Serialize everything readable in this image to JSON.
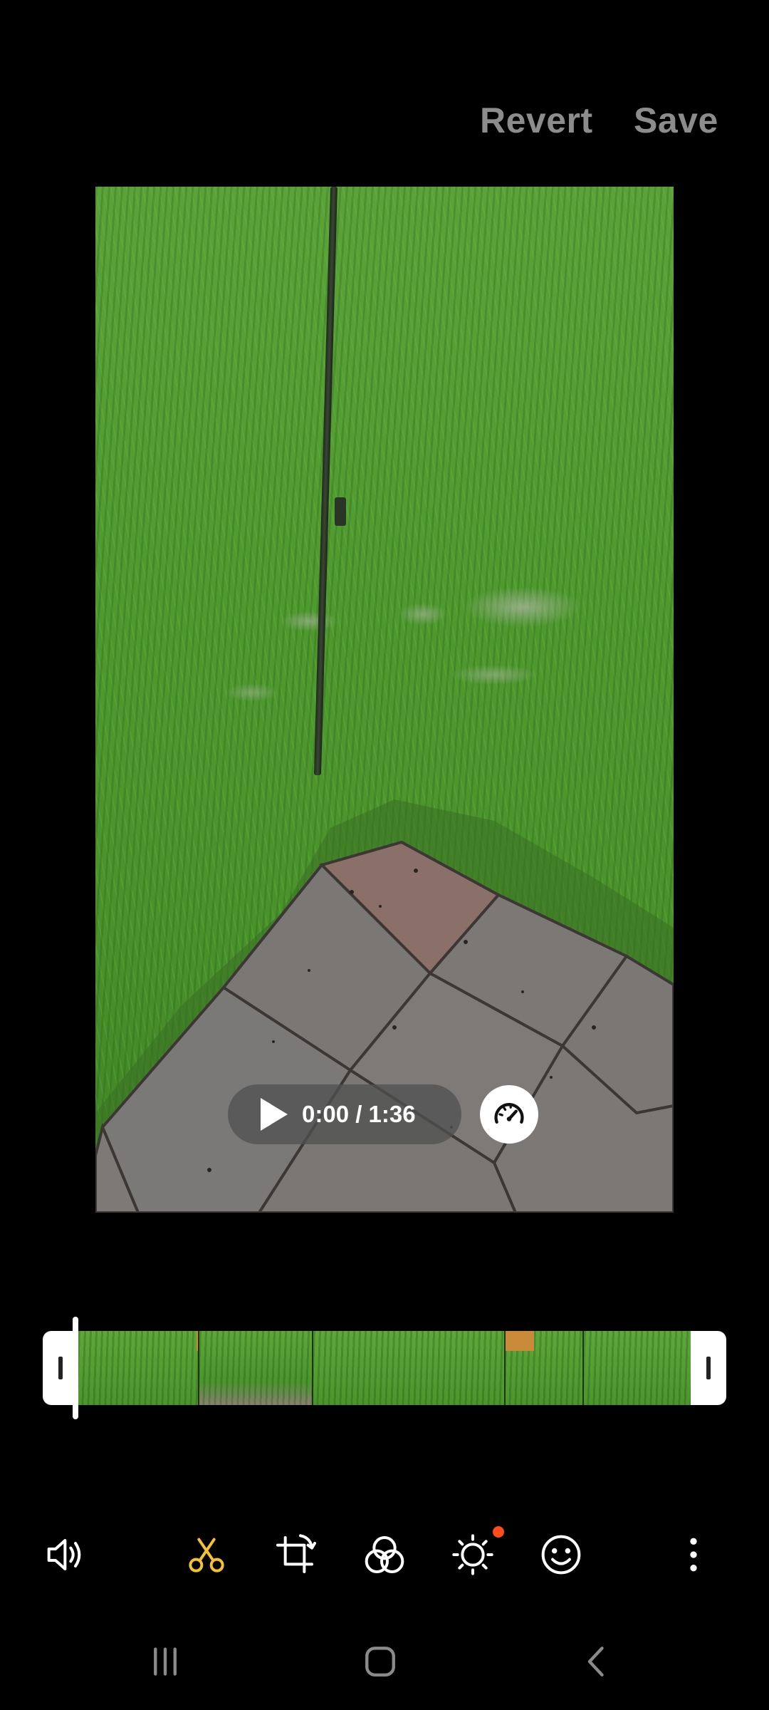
{
  "header": {
    "revert_label": "Revert",
    "save_label": "Save"
  },
  "player": {
    "time": "0:00 / 1:36",
    "play_icon": "play-icon",
    "speed_icon": "speedometer-icon"
  },
  "trim": {
    "progress_fraction": 0.0
  },
  "toolbar": {
    "items": [
      {
        "name": "volume-icon",
        "active": false
      },
      {
        "name": "trim-scissors-icon",
        "active": true
      },
      {
        "name": "crop-rotate-icon",
        "active": false
      },
      {
        "name": "filters-icon",
        "active": false
      },
      {
        "name": "brightness-adjust-icon",
        "active": false,
        "badge": true
      },
      {
        "name": "sticker-emoji-icon",
        "active": false
      },
      {
        "name": "more-options-icon",
        "active": false
      }
    ],
    "accent_color": "#f2c230",
    "badge_color": "#ff4d1a"
  },
  "navigation": {
    "recents_icon": "recents-icon",
    "home_icon": "home-icon",
    "back_icon": "back-icon"
  }
}
